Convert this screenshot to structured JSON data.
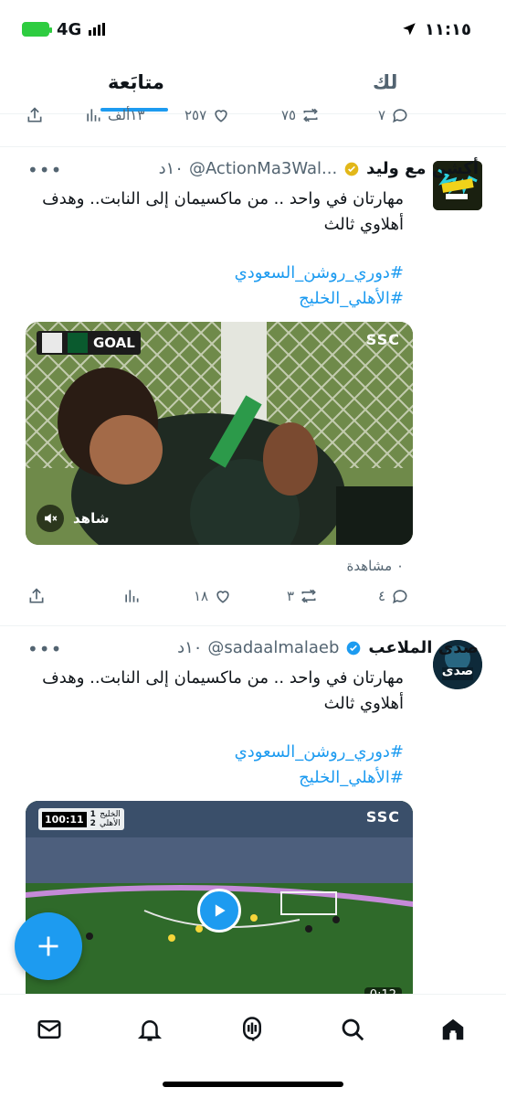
{
  "status": {
    "time": "١١:١٥",
    "network": "4G"
  },
  "tabs": {
    "following": "متابَعة",
    "for_you": "لك"
  },
  "top_actions": {
    "views": "١٣ألف",
    "likes": "٢٥٧",
    "retweets": "٧٥",
    "replies": "٧"
  },
  "tweets": [
    {
      "name": "أكشن مع وليد",
      "handle": "@ActionMa3Wal...",
      "time": "١٠د",
      "text": "مهارتان في واحد .. من ماكسيمان إلى النابت.. وهدف أهلاوي ثالث",
      "hashtags": [
        "#دوري_روشن_السعودي",
        "#الأهلي_الخليج"
      ],
      "media": {
        "badge": "GOAL",
        "brand": "SSC",
        "watermark": "شاهد"
      },
      "views": "٠ مشاهدة",
      "likes": "١٨",
      "retweets": "٣",
      "replies": "٤",
      "verified_color": "#e2b719"
    },
    {
      "name": "صدى الملاعب",
      "handle": "@sadaalmalaeb",
      "time": "١٠د",
      "text": "مهارتان في واحد .. من ماكسيمان إلى النابت.. وهدف أهلاوي ثالث",
      "hashtags": [
        "#دوري_روشن_السعودي",
        "#الأهلي_الخليج"
      ],
      "media": {
        "brand": "SSC",
        "score_time": "100:11",
        "team1": "الخليج",
        "team2": "الأهلي",
        "score1": "1",
        "score2": "2",
        "duration": "0:12"
      },
      "verified_color": "#1d9bf0",
      "avatar_text": "صدى"
    }
  ],
  "colors": {
    "accent": "#1d9bf0",
    "secondary_text": "#536471"
  }
}
